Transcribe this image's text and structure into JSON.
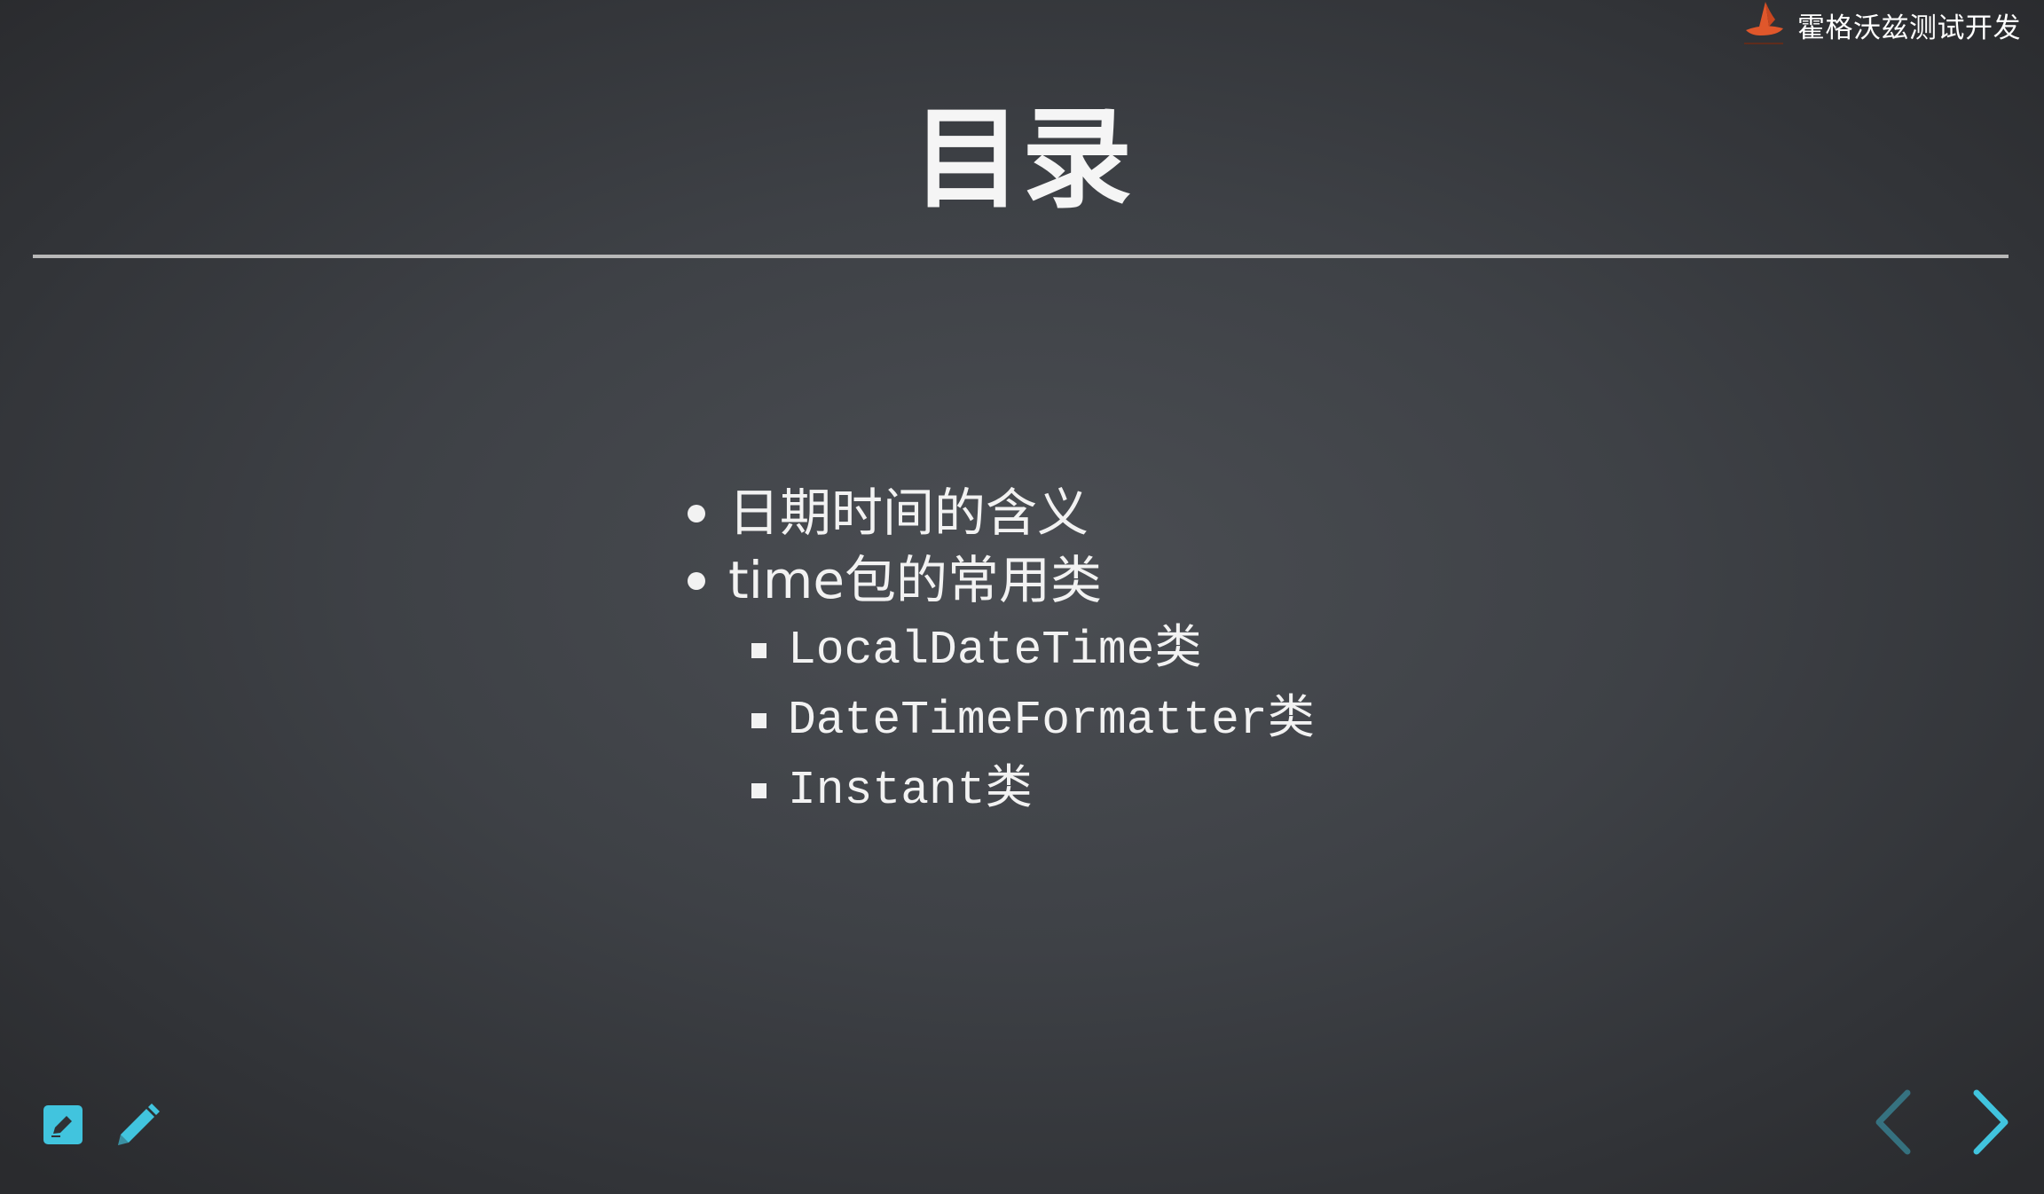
{
  "brand": {
    "name": "霍格沃兹测试开发",
    "logo_icon": "wizard-hat-icon",
    "logo_color": "#e0572b"
  },
  "slide": {
    "title": "目录",
    "items": [
      {
        "label": "日期时间的含义"
      },
      {
        "label": "time包的常用类",
        "children": [
          {
            "label": "LocalDateTime类"
          },
          {
            "label": "DateTimeFormatter类"
          },
          {
            "label": "Instant类"
          }
        ]
      }
    ]
  },
  "controls": {
    "accent_color": "#41c4de",
    "left": [
      {
        "icon": "edit-box-icon"
      },
      {
        "icon": "pencil-icon"
      }
    ],
    "right": [
      {
        "icon": "chevron-left-icon",
        "disabled": true
      },
      {
        "icon": "chevron-right-icon",
        "disabled": false
      }
    ]
  }
}
